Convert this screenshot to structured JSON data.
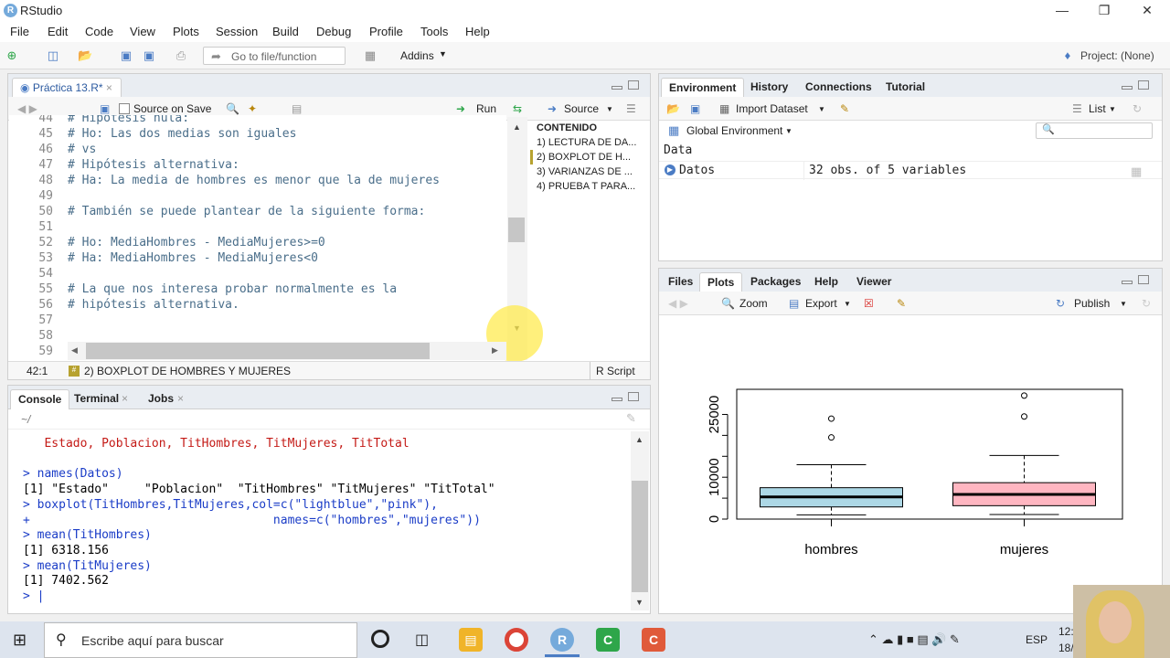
{
  "window": {
    "title": "RStudio"
  },
  "menu": [
    "File",
    "Edit",
    "Code",
    "View",
    "Plots",
    "Session",
    "Build",
    "Debug",
    "Profile",
    "Tools",
    "Help"
  ],
  "toolbar": {
    "goto_placeholder": "Go to file/function",
    "addins": "Addins",
    "project": "Project: (None)"
  },
  "editor": {
    "tab": "Práctica 13.R*",
    "source_on_save": "Source on Save",
    "run": "Run",
    "source": "Source",
    "lines": [
      {
        "n": "44",
        "t": "# Hipótesis nula:"
      },
      {
        "n": "45",
        "t": "# Ho: Las dos medias son iguales"
      },
      {
        "n": "46",
        "t": "# vs"
      },
      {
        "n": "47",
        "t": "# Hipótesis alternativa:"
      },
      {
        "n": "48",
        "t": "# Ha: La media de hombres es menor que la de mujeres"
      },
      {
        "n": "49",
        "t": ""
      },
      {
        "n": "50",
        "t": "# También se puede plantear de la siguiente forma:"
      },
      {
        "n": "51",
        "t": ""
      },
      {
        "n": "52",
        "t": "# Ho: MediaHombres - MediaMujeres>=0"
      },
      {
        "n": "53",
        "t": "# Ha: MediaHombres - MediaMujeres<0"
      },
      {
        "n": "54",
        "t": ""
      },
      {
        "n": "55",
        "t": "# La que nos interesa probar normalmente es la"
      },
      {
        "n": "56",
        "t": "# hipótesis alternativa."
      },
      {
        "n": "57",
        "t": ""
      },
      {
        "n": "58",
        "t": ""
      },
      {
        "n": "59",
        "t": ""
      }
    ],
    "outline_title": "CONTENIDO",
    "outline": [
      "1) LECTURA DE DA...",
      "2) BOXPLOT DE H...",
      "3) VARIANZAS DE ...",
      "4) PRUEBA T PARA..."
    ],
    "status_pos": "42:1",
    "status_section": "2) BOXPLOT DE HOMBRES Y MUJERES",
    "status_type": "R Script"
  },
  "console": {
    "tabs": [
      "Console",
      "Terminal",
      "Jobs"
    ],
    "path": "~/",
    "lines": [
      {
        "c": "red",
        "t": "   Estado, Poblacion, TitHombres, TitMujeres, TitTotal"
      },
      {
        "c": "blank",
        "t": ""
      },
      {
        "c": "blue",
        "t": "> names(Datos)"
      },
      {
        "c": "black",
        "t": "[1] \"Estado\"     \"Poblacion\"  \"TitHombres\" \"TitMujeres\" \"TitTotal\""
      },
      {
        "c": "blue",
        "t": "> boxplot(TitHombres,TitMujeres,col=c(\"lightblue\",\"pink\"),"
      },
      {
        "c": "blue",
        "t": "+                                  names=c(\"hombres\",\"mujeres\"))"
      },
      {
        "c": "blue",
        "t": "> mean(TitHombres)"
      },
      {
        "c": "black",
        "t": "[1] 6318.156"
      },
      {
        "c": "blue",
        "t": "> mean(TitMujeres)"
      },
      {
        "c": "black",
        "t": "[1] 7402.562"
      },
      {
        "c": "blue",
        "t": "> |"
      }
    ]
  },
  "environment": {
    "tabs": [
      "Environment",
      "History",
      "Connections",
      "Tutorial"
    ],
    "import_dataset": "Import Dataset",
    "list_view": "List",
    "scope": "Global Environment",
    "section": "Data",
    "rows": [
      {
        "name": "Datos",
        "value": "32 obs. of 5 variables"
      }
    ]
  },
  "files": {
    "tabs": [
      "Files",
      "Plots",
      "Packages",
      "Help",
      "Viewer"
    ],
    "zoom": "Zoom",
    "export": "Export",
    "publish": "Publish"
  },
  "chart_data": {
    "type": "boxplot",
    "categories": [
      "hombres",
      "mujeres"
    ],
    "colors": [
      "#add8e6",
      "#ffb6c1"
    ],
    "yticks": [
      "0",
      "10000",
      "25000"
    ],
    "ylim": [
      0,
      31000
    ],
    "boxes": [
      {
        "name": "hombres",
        "min": 1000,
        "q1": 2900,
        "median": 5300,
        "q3": 7500,
        "max": 13000,
        "outliers": [
          19500,
          24000
        ]
      },
      {
        "name": "mujeres",
        "min": 1100,
        "q1": 3200,
        "median": 5900,
        "q3": 8700,
        "max": 15200,
        "outliers": [
          24500,
          29500
        ]
      }
    ]
  },
  "taskbar": {
    "search": "Escribe aquí para buscar",
    "lang": "ESP",
    "time": "12:",
    "date": "18/"
  },
  "colors": {
    "accent": "#4b7cc4",
    "taskbar": "#dde4ee"
  }
}
